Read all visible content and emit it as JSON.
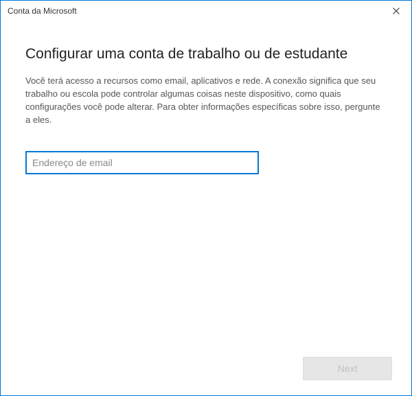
{
  "window": {
    "title": "Conta da Microsoft"
  },
  "heading": "Configurar uma conta de trabalho ou de estudante",
  "description": "Você terá acesso a recursos como email, aplicativos e rede. A conexão significa que seu trabalho ou escola pode controlar algumas coisas neste dispositivo, como quais configurações você pode alterar. Para obter informações específicas sobre isso, pergunte a eles.",
  "email": {
    "placeholder": "Endereço de email",
    "value": ""
  },
  "buttons": {
    "next": "Next"
  }
}
